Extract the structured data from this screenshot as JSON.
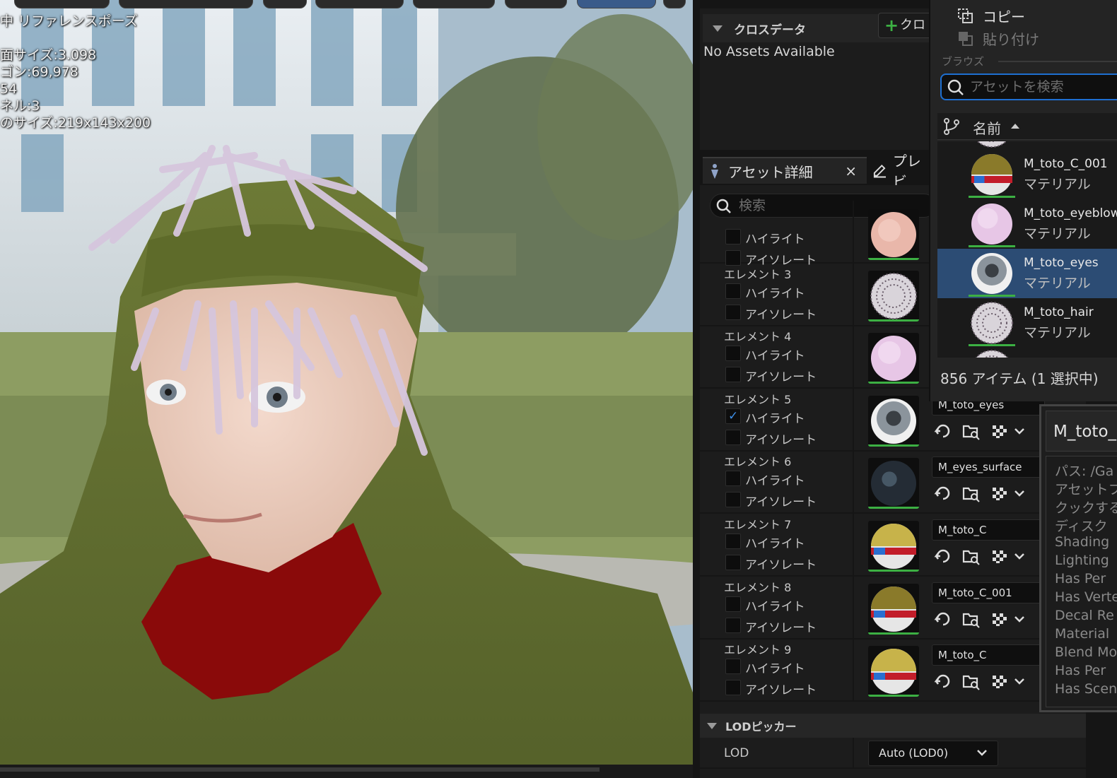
{
  "viewport": {
    "stats": [
      "中 リファレンスポーズ",
      "面サイズ:3.098",
      "ゴン:69,978",
      "54",
      "ネル:3",
      "のサイズ:219x143x200"
    ]
  },
  "cloth_panel": {
    "title": "クロスデータ",
    "add_button": "クロ",
    "empty_text": "No Assets Available"
  },
  "tabs": {
    "asset_details": "アセット詳細",
    "preview": "プレビ",
    "close": "×"
  },
  "details": {
    "search_placeholder": "検索",
    "highlight": "ハイライト",
    "isolate": "アイソレート",
    "elements": [
      {
        "label": "",
        "highlight_checked": false,
        "material": "",
        "thumb": "skin"
      },
      {
        "label": "エレメント 3",
        "highlight_checked": false,
        "material": "",
        "thumb": "hair"
      },
      {
        "label": "エレメント 4",
        "highlight_checked": false,
        "material": "",
        "thumb": "pink"
      },
      {
        "label": "エレメント 5",
        "highlight_checked": true,
        "material": "M_toto_eyes",
        "thumb": "eye"
      },
      {
        "label": "エレメント 6",
        "highlight_checked": false,
        "material": "M_eyes_surface",
        "thumb": "dark"
      },
      {
        "label": "エレメント 7",
        "highlight_checked": false,
        "material": "M_toto_C",
        "thumb": "ball"
      },
      {
        "label": "エレメント 8",
        "highlight_checked": false,
        "material": "M_toto_C_001",
        "thumb": "ball2"
      },
      {
        "label": "エレメント 9",
        "highlight_checked": false,
        "material": "M_toto_C",
        "thumb": "ball"
      }
    ],
    "lod_section": "LODピッカー",
    "lod_label": "LOD",
    "lod_value": "Auto (LOD0)"
  },
  "browser": {
    "copy": "コピー",
    "paste": "貼り付け",
    "browse_label": "ブラウズ",
    "search_placeholder": "アセットを検索",
    "name_column": "名前",
    "assets": [
      {
        "name": "M_toto_C_001",
        "type": "マテリアル",
        "thumb": "ball2",
        "selected": false
      },
      {
        "name": "M_toto_eyeblow",
        "type": "マテリアル",
        "thumb": "pink",
        "selected": false
      },
      {
        "name": "M_toto_eyes",
        "type": "マテリアル",
        "thumb": "eye",
        "selected": true
      },
      {
        "name": "M_toto_hair",
        "type": "マテリアル",
        "thumb": "hair",
        "selected": false
      }
    ],
    "count": "856 アイテム (1 選択中)"
  },
  "tooltip": {
    "title": "M_toto_",
    "lines": [
      "パス: /Ga",
      "アセットフ",
      "クックする",
      "ディスク",
      "Shading",
      "Lighting",
      "Has Per",
      "Has Verte",
      "Decal Re",
      "Material",
      "Blend Mo",
      "Has Per",
      "Has Scen"
    ]
  },
  "colors": {
    "accent_blue": "#1e6fd1",
    "selection": "#2c4c74",
    "thumb_bar": "#3cb043",
    "check": "#3d8fe8"
  }
}
